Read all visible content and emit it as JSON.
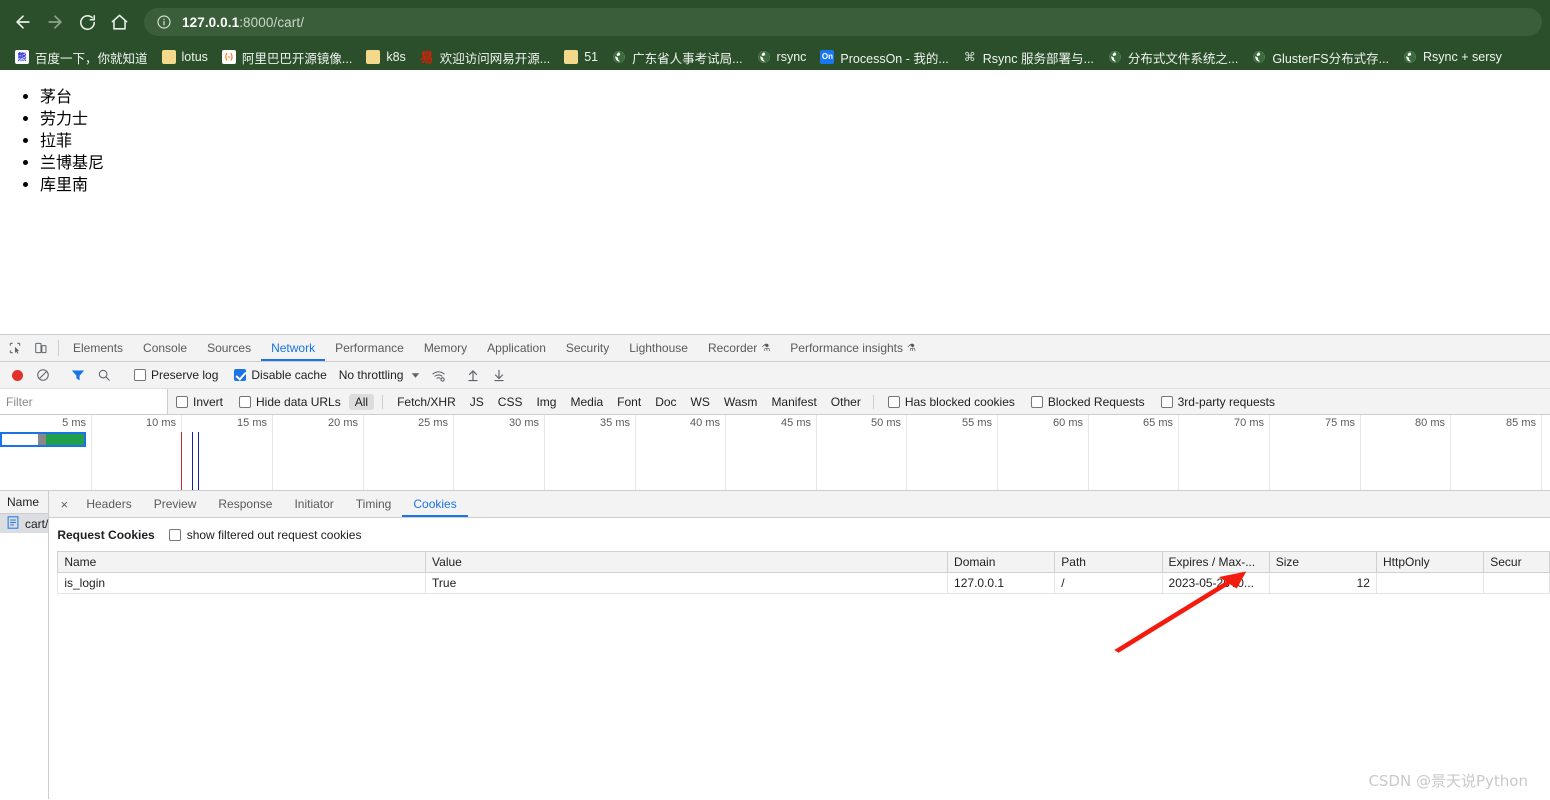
{
  "browser": {
    "nav": {
      "back_label": "Back",
      "forward_label": "Forward",
      "reload_label": "Reload",
      "home_label": "Home"
    },
    "omnibox": {
      "site_info_icon": "info-circle-icon",
      "url_host": "127.0.0.1",
      "url_rest": ":8000/cart/",
      "url_full": "127.0.0.1:8000/cart/"
    },
    "bookmarks": [
      {
        "label": "百度一下，你就知道",
        "icon": "baidu-icon"
      },
      {
        "label": "lotus",
        "icon": "folder-icon"
      },
      {
        "label": "阿里巴巴开源镜像...",
        "icon": "alibaba-icon"
      },
      {
        "label": "k8s",
        "icon": "folder-icon"
      },
      {
        "label": "欢迎访问网易开源...",
        "icon": "netease-icon"
      },
      {
        "label": "51",
        "icon": "folder-icon"
      },
      {
        "label": "广东省人事考试局...",
        "icon": "globe-icon"
      },
      {
        "label": "rsync",
        "icon": "globe-icon"
      },
      {
        "label": "ProcessOn - 我的...",
        "icon": "processon-icon"
      },
      {
        "label": "Rsync 服务部署与...",
        "icon": "rsync-icon"
      },
      {
        "label": "分布式文件系统之...",
        "icon": "globe-icon"
      },
      {
        "label": "GlusterFS分布式存...",
        "icon": "globe-icon"
      },
      {
        "label": "Rsync + sersy",
        "icon": "globe-icon"
      }
    ]
  },
  "page": {
    "list_items": [
      "茅台",
      "劳力士",
      "拉菲",
      "兰博基尼",
      "库里南"
    ]
  },
  "devtools": {
    "left_icons": [
      {
        "name": "inspect-element-icon"
      },
      {
        "name": "device-toolbar-icon"
      }
    ],
    "tabs": [
      {
        "label": "Elements",
        "active": false
      },
      {
        "label": "Console",
        "active": false
      },
      {
        "label": "Sources",
        "active": false
      },
      {
        "label": "Network",
        "active": true
      },
      {
        "label": "Performance",
        "active": false
      },
      {
        "label": "Memory",
        "active": false
      },
      {
        "label": "Application",
        "active": false
      },
      {
        "label": "Security",
        "active": false
      },
      {
        "label": "Lighthouse",
        "active": false
      },
      {
        "label": "Recorder",
        "active": false,
        "badge": "experiment-icon"
      },
      {
        "label": "Performance insights",
        "active": false,
        "badge": "experiment-icon"
      }
    ],
    "network_toolbar": {
      "record_label": "Record",
      "clear_label": "Clear",
      "filter_label": "Filter",
      "search_label": "Search",
      "preserve_log": {
        "label": "Preserve log",
        "checked": false
      },
      "disable_cache": {
        "label": "Disable cache",
        "checked": true
      },
      "throttle_value": "No throttling",
      "throttle_caret": "▼",
      "wifi_settings_label": "Network conditions",
      "import_label": "Import HAR",
      "export_label": "Export HAR"
    },
    "filter_bar": {
      "input_value": "",
      "input_placeholder": "Filter",
      "invert": {
        "label": "Invert",
        "checked": false
      },
      "hide_data_urls": {
        "label": "Hide data URLs",
        "checked": false
      },
      "types": [
        "All",
        "Fetch/XHR",
        "JS",
        "CSS",
        "Img",
        "Media",
        "Font",
        "Doc",
        "WS",
        "Wasm",
        "Manifest",
        "Other"
      ],
      "active_type": "All",
      "has_blocked_cookies": {
        "label": "Has blocked cookies",
        "checked": false
      },
      "blocked_requests": {
        "label": "Blocked Requests",
        "checked": false
      },
      "third_party": {
        "label": "3rd-party requests",
        "checked": false
      }
    },
    "timeline": {
      "ticks": [
        "5 ms",
        "10 ms",
        "15 ms",
        "20 ms",
        "25 ms",
        "30 ms",
        "35 ms",
        "40 ms",
        "45 ms",
        "50 ms",
        "55 ms",
        "60 ms",
        "65 ms",
        "70 ms",
        "75 ms",
        "80 ms",
        "85 ms"
      ],
      "selection_segments": [
        "white",
        "gray",
        "green",
        "blue"
      ],
      "event_lines": [
        {
          "color": "red",
          "position_ms": 10.0
        },
        {
          "color": "blue",
          "position_ms": 10.6
        },
        {
          "color": "blue",
          "position_ms": 10.9
        }
      ]
    },
    "request_list": {
      "header": "Name",
      "rows": [
        {
          "name": "cart/",
          "icon": "document-icon",
          "selected": true
        }
      ]
    },
    "detail": {
      "close_label": "×",
      "tabs": [
        {
          "label": "Headers",
          "active": false
        },
        {
          "label": "Preview",
          "active": false
        },
        {
          "label": "Response",
          "active": false
        },
        {
          "label": "Initiator",
          "active": false
        },
        {
          "label": "Timing",
          "active": false
        },
        {
          "label": "Cookies",
          "active": true
        }
      ],
      "cookies": {
        "section_title": "Request Cookies",
        "show_filtered_label": "show filtered out request cookies",
        "show_filtered_checked": false,
        "columns": [
          "Name",
          "Value",
          "Domain",
          "Path",
          "Expires / Max-...",
          "Size",
          "HttpOnly",
          "Secur"
        ],
        "rows": [
          {
            "Name": "is_login",
            "Value": "True",
            "Domain": "127.0.0.1",
            "Path": "/",
            "Expires": "2023-05-26T0...",
            "Size": "12",
            "HttpOnly": "",
            "Secure": ""
          }
        ]
      }
    }
  },
  "annotation": {
    "arrow_color": "#f31b0e",
    "arrow_name": "red-pointer-arrow"
  },
  "watermark": {
    "text": "CSDN @景天说Python"
  }
}
